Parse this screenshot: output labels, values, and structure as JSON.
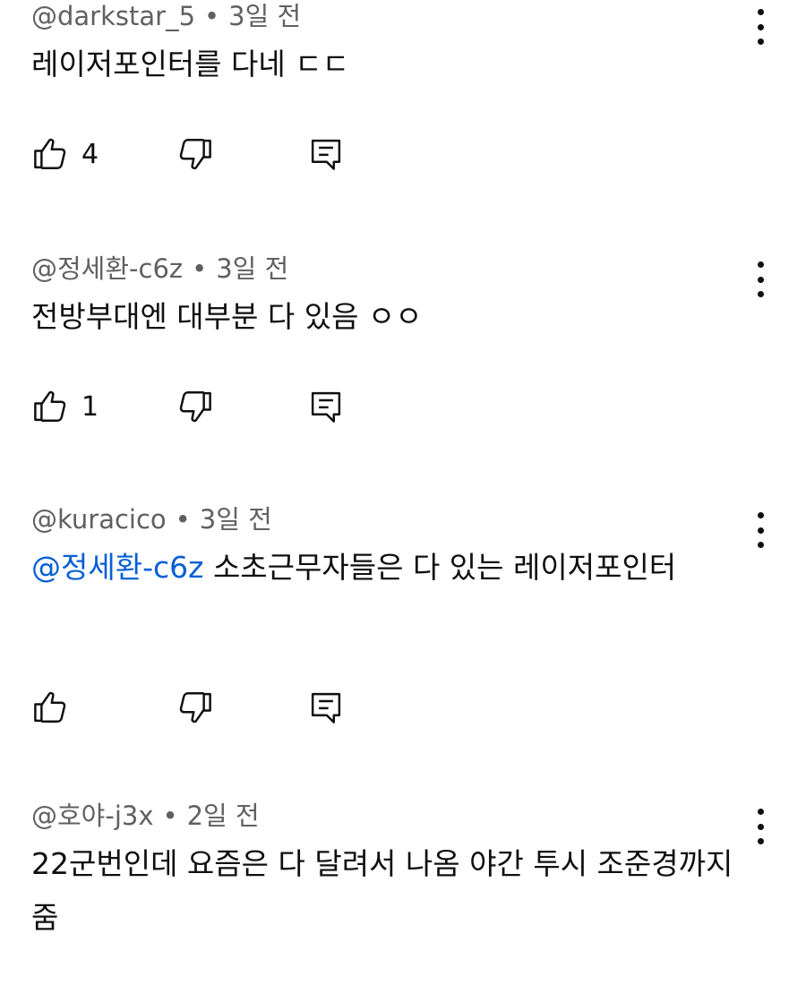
{
  "comments": [
    {
      "author": "@darkstar_5",
      "time": "3일 전",
      "mention": "",
      "text": "레이저포인터를 다네 ㄷㄷ",
      "likes": "4"
    },
    {
      "author": "@정세환-c6z",
      "time": "3일 전",
      "mention": "",
      "text": "전방부대엔 대부분 다 있음 ㅇㅇ",
      "likes": "1"
    },
    {
      "author": "@kuracico",
      "time": "3일 전",
      "mention": "@정세환-c6z",
      "text": " 소초근무자들은 다 있는 레이저포인터",
      "likes": ""
    },
    {
      "author": "@호야-j3x",
      "time": "2일 전",
      "mention": "",
      "text": "22군번인데 요즘은 다 달려서 나옴 야간 투시 조준경까지 줌",
      "likes": ""
    }
  ],
  "separator": "•",
  "icons": {
    "like": "thumbs-up-icon",
    "dislike": "thumbs-down-icon",
    "reply": "reply-comment-icon",
    "menu": "more-vertical-icon"
  }
}
